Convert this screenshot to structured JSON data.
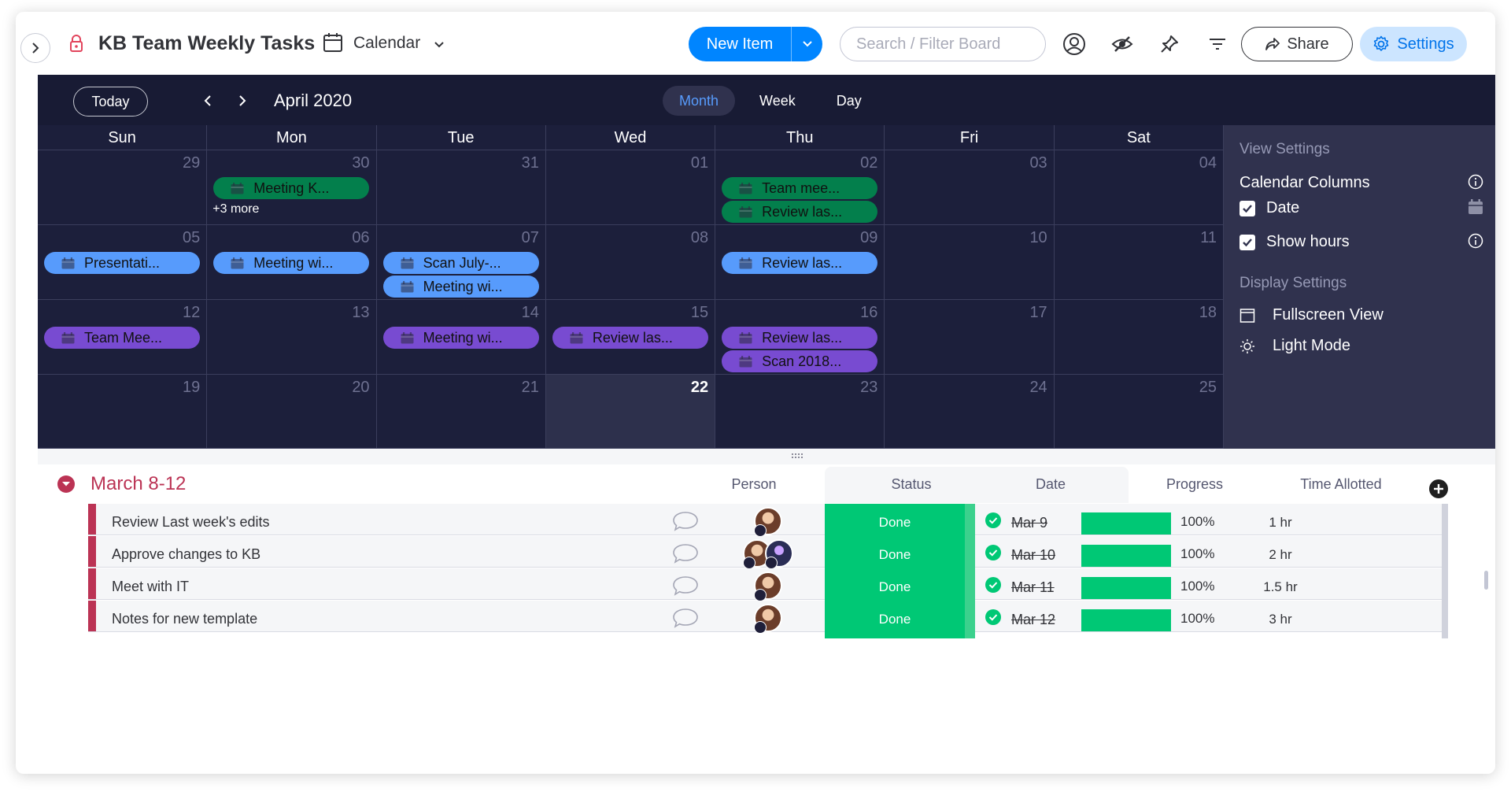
{
  "header": {
    "title": "KB Team Weekly Tasks",
    "view_name": "Calendar",
    "new_item_label": "New Item",
    "search_placeholder": "Search / Filter Board",
    "share_label": "Share",
    "settings_label": "Settings"
  },
  "toolbar": {
    "today_label": "Today",
    "month_title": "April 2020",
    "views": [
      {
        "label": "Month",
        "active": true
      },
      {
        "label": "Week",
        "active": false
      },
      {
        "label": "Day",
        "active": false
      }
    ]
  },
  "calendar": {
    "weekdays": [
      "Sun",
      "Mon",
      "Tue",
      "Wed",
      "Thu",
      "Fri",
      "Sat"
    ],
    "weeks": [
      [
        {
          "num": "29",
          "events": []
        },
        {
          "num": "30",
          "events": [
            {
              "label": "Meeting K...",
              "color": "green"
            }
          ],
          "more": "+3 more"
        },
        {
          "num": "31",
          "events": []
        },
        {
          "num": "01",
          "events": []
        },
        {
          "num": "02",
          "events": [
            {
              "label": "Team mee...",
              "color": "green"
            },
            {
              "label": "Review las...",
              "color": "green"
            }
          ]
        },
        {
          "num": "03",
          "events": []
        },
        {
          "num": "04",
          "events": []
        }
      ],
      [
        {
          "num": "05",
          "events": [
            {
              "label": "Presentati...",
              "color": "blue"
            }
          ]
        },
        {
          "num": "06",
          "events": [
            {
              "label": "Meeting wi...",
              "color": "blue"
            }
          ]
        },
        {
          "num": "07",
          "events": [
            {
              "label": "Scan July-...",
              "color": "blue"
            },
            {
              "label": "Meeting wi...",
              "color": "blue"
            }
          ]
        },
        {
          "num": "08",
          "events": []
        },
        {
          "num": "09",
          "events": [
            {
              "label": "Review las...",
              "color": "blue"
            }
          ]
        },
        {
          "num": "10",
          "events": []
        },
        {
          "num": "11",
          "events": []
        }
      ],
      [
        {
          "num": "12",
          "events": [
            {
              "label": "Team Mee...",
              "color": "purple"
            }
          ]
        },
        {
          "num": "13",
          "events": []
        },
        {
          "num": "14",
          "events": [
            {
              "label": "Meeting wi...",
              "color": "purple"
            }
          ]
        },
        {
          "num": "15",
          "events": [
            {
              "label": "Review las...",
              "color": "purple"
            }
          ]
        },
        {
          "num": "16",
          "events": [
            {
              "label": "Review las...",
              "color": "purple"
            },
            {
              "label": "Scan 2018...",
              "color": "purple"
            }
          ]
        },
        {
          "num": "17",
          "events": []
        },
        {
          "num": "18",
          "events": []
        }
      ],
      [
        {
          "num": "19",
          "events": []
        },
        {
          "num": "20",
          "events": []
        },
        {
          "num": "21",
          "events": []
        },
        {
          "num": "22",
          "events": [],
          "today": true
        },
        {
          "num": "23",
          "events": []
        },
        {
          "num": "24",
          "events": []
        },
        {
          "num": "25",
          "events": []
        }
      ]
    ]
  },
  "side_panel": {
    "view_settings_title": "View Settings",
    "calendar_columns_label": "Calendar Columns",
    "date_label": "Date",
    "show_hours_label": "Show hours",
    "display_settings_title": "Display Settings",
    "fullscreen_label": "Fullscreen View",
    "light_mode_label": "Light Mode"
  },
  "table": {
    "group_title": "March 8-12",
    "columns": {
      "person": "Person",
      "status": "Status",
      "date": "Date",
      "progress": "Progress",
      "time": "Time Allotted"
    },
    "rows": [
      {
        "name": "Review Last week's edits",
        "status": "Done",
        "date": "Mar 9",
        "progress": "100%",
        "time": "1 hr"
      },
      {
        "name": "Approve changes to KB",
        "status": "Done",
        "date": "Mar 10",
        "progress": "100%",
        "time": "2 hr"
      },
      {
        "name": "Meet with IT",
        "status": "Done",
        "date": "Mar 11",
        "progress": "100%",
        "time": "1.5 hr"
      },
      {
        "name": "Notes for new template",
        "status": "Done",
        "date": "Mar 12",
        "progress": "100%",
        "time": "3 hr"
      }
    ]
  },
  "colors": {
    "accent": "#0085ff",
    "calendar_bg": "#1c1f3b",
    "event_green": "#037f4c",
    "event_blue": "#579bfc",
    "event_purple": "#784bd1",
    "group": "#bb3354",
    "done": "#00c875"
  }
}
